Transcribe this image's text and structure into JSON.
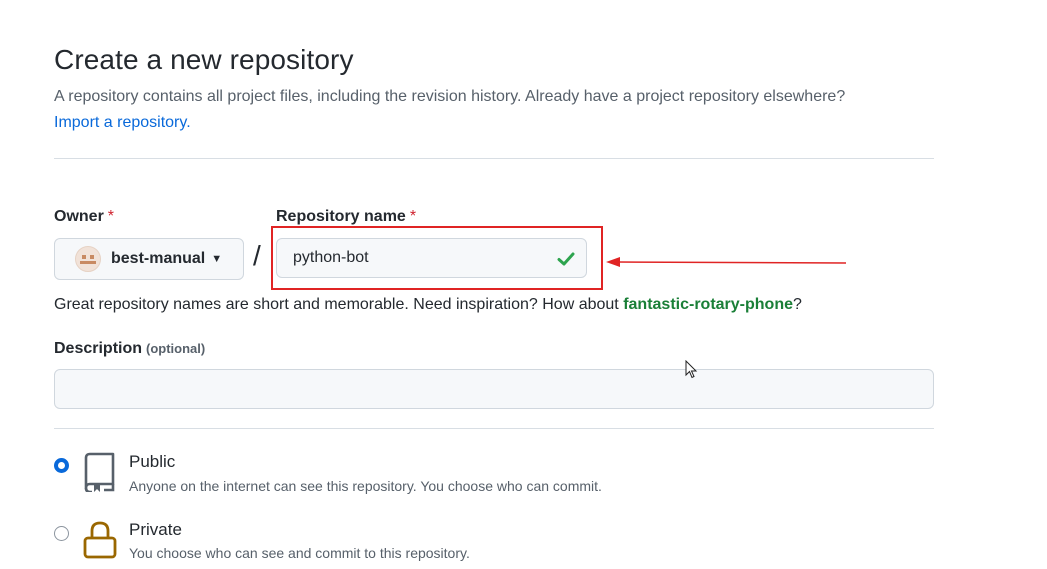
{
  "header": {
    "title": "Create a new repository",
    "subtitle": "A repository contains all project files, including the revision history. Already have a project repository elsewhere?",
    "import_link": "Import a repository."
  },
  "owner": {
    "label": "Owner",
    "required_mark": "*",
    "value": "best-manual"
  },
  "separator": "/",
  "repository": {
    "label": "Repository name",
    "required_mark": "*",
    "value": "python-bot",
    "status_icon": "check-icon"
  },
  "hint": {
    "text": "Great repository names are short and memorable. Need inspiration? How about ",
    "suggestion": "fantastic-rotary-phone",
    "suffix": "?"
  },
  "description": {
    "label": "Description",
    "optional": "(optional)",
    "value": ""
  },
  "visibility": {
    "selected": "public",
    "options": [
      {
        "id": "public",
        "title": "Public",
        "desc": "Anyone on the internet can see this repository. You choose who can commit.",
        "icon": "repo-icon"
      },
      {
        "id": "private",
        "title": "Private",
        "desc": "You choose who can see and commit to this repository.",
        "icon": "lock-icon"
      }
    ]
  },
  "annotation": {
    "highlight_color": "#e02424"
  },
  "colors": {
    "link": "#0969da",
    "success": "#1a7f37",
    "required": "#cf222e"
  }
}
